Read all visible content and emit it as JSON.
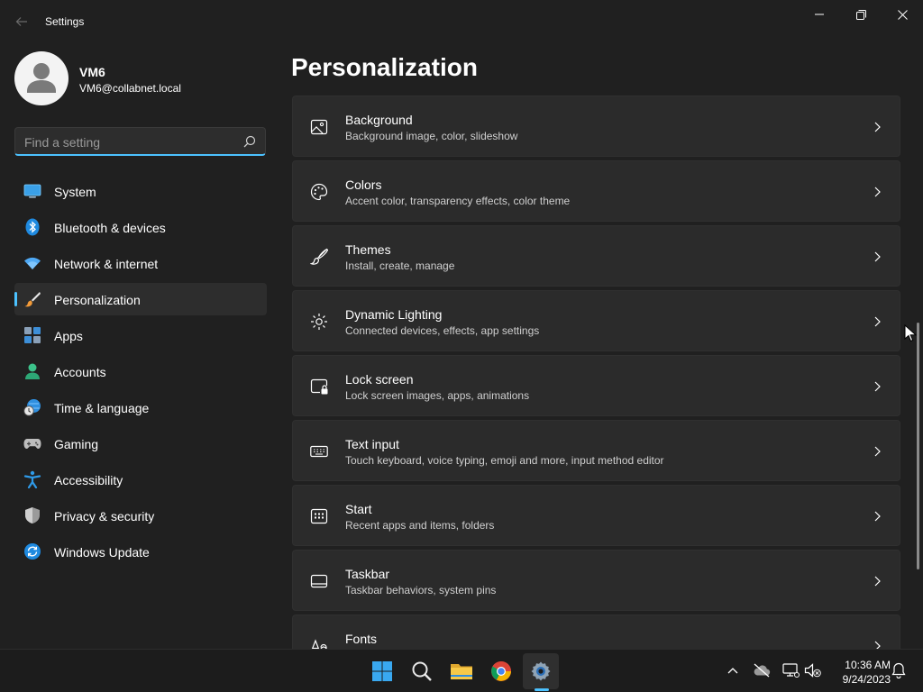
{
  "window": {
    "title": "Settings"
  },
  "profile": {
    "name": "VM6",
    "email": "VM6@collabnet.local"
  },
  "search": {
    "placeholder": "Find a setting"
  },
  "sidebar": {
    "items": [
      {
        "label": "System",
        "icon": "system-icon"
      },
      {
        "label": "Bluetooth & devices",
        "icon": "bluetooth-icon"
      },
      {
        "label": "Network & internet",
        "icon": "wifi-icon"
      },
      {
        "label": "Personalization",
        "icon": "brush-icon",
        "active": true
      },
      {
        "label": "Apps",
        "icon": "apps-icon"
      },
      {
        "label": "Accounts",
        "icon": "accounts-icon"
      },
      {
        "label": "Time & language",
        "icon": "time-language-icon"
      },
      {
        "label": "Gaming",
        "icon": "gamepad-icon"
      },
      {
        "label": "Accessibility",
        "icon": "accessibility-icon"
      },
      {
        "label": "Privacy & security",
        "icon": "shield-icon"
      },
      {
        "label": "Windows Update",
        "icon": "update-icon"
      }
    ]
  },
  "main": {
    "title": "Personalization",
    "cards": [
      {
        "title": "Background",
        "subtitle": "Background image, color, slideshow",
        "icon": "image-icon"
      },
      {
        "title": "Colors",
        "subtitle": "Accent color, transparency effects, color theme",
        "icon": "palette-icon"
      },
      {
        "title": "Themes",
        "subtitle": "Install, create, manage",
        "icon": "brush-icon"
      },
      {
        "title": "Dynamic Lighting",
        "subtitle": "Connected devices, effects, app settings",
        "icon": "lighting-icon"
      },
      {
        "title": "Lock screen",
        "subtitle": "Lock screen images, apps, animations",
        "icon": "lock-screen-icon"
      },
      {
        "title": "Text input",
        "subtitle": "Touch keyboard, voice typing, emoji and more, input method editor",
        "icon": "keyboard-icon"
      },
      {
        "title": "Start",
        "subtitle": "Recent apps and items, folders",
        "icon": "start-icon"
      },
      {
        "title": "Taskbar",
        "subtitle": "Taskbar behaviors, system pins",
        "icon": "taskbar-icon"
      },
      {
        "title": "Fonts",
        "subtitle": "",
        "icon": "fonts-icon"
      }
    ]
  },
  "taskbar": {
    "apps": [
      "windows-start-icon",
      "search-icon",
      "file-explorer-icon",
      "chrome-icon",
      "settings-icon"
    ],
    "time": "10:36 AM",
    "date": "9/24/2023"
  },
  "colors": {
    "accent": "#4cc2ff",
    "background": "#202020",
    "card": "#2b2b2b"
  }
}
